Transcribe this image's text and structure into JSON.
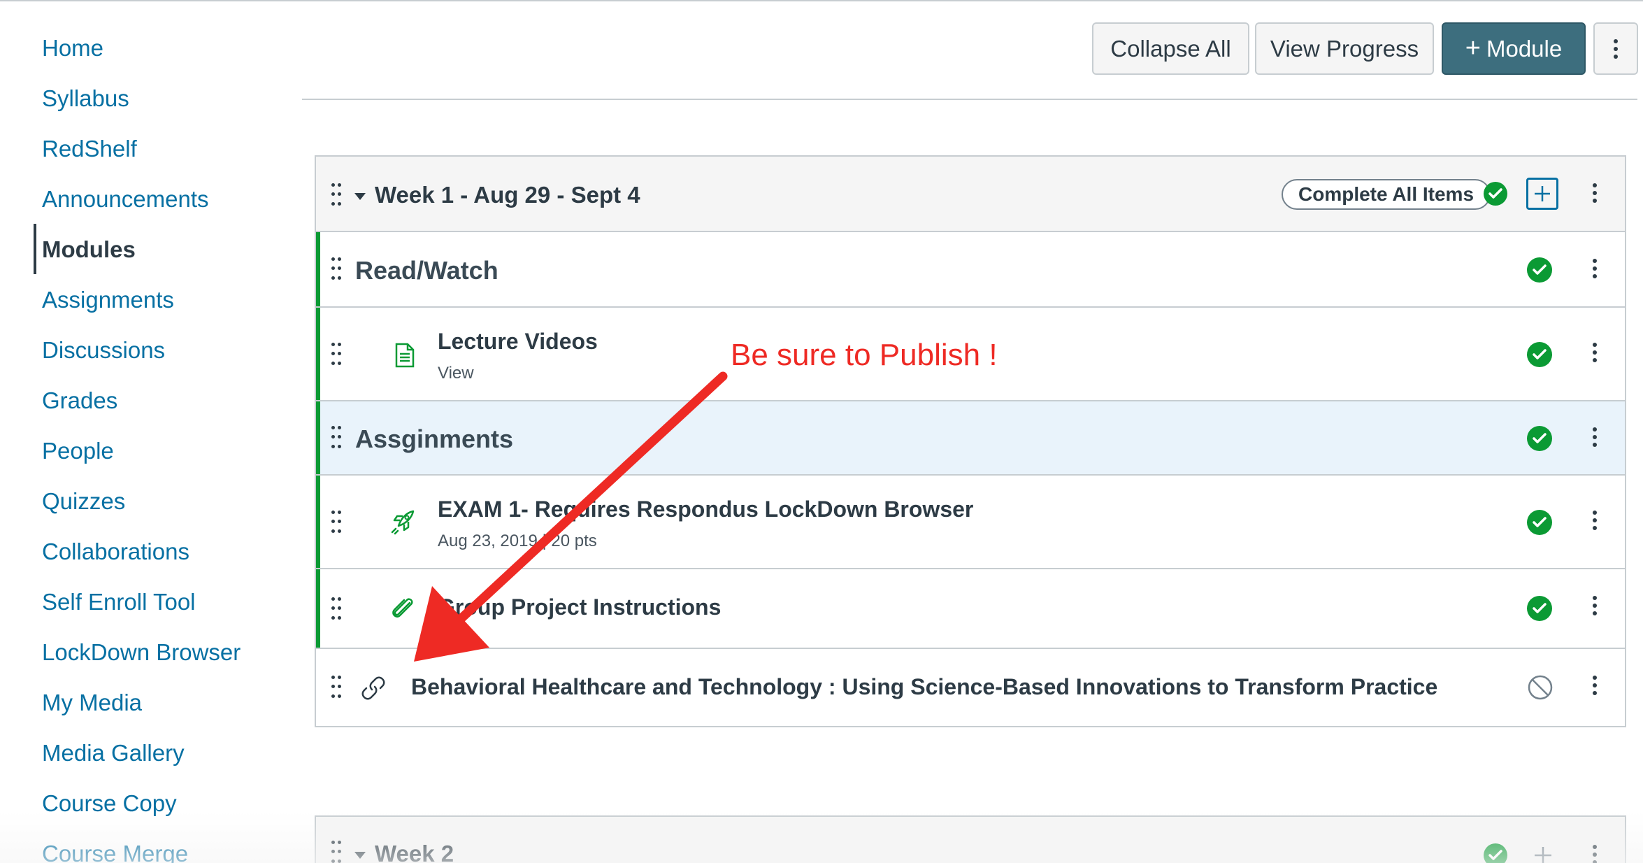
{
  "sidebar": {
    "items": [
      {
        "label": "Home"
      },
      {
        "label": "Syllabus"
      },
      {
        "label": "RedShelf"
      },
      {
        "label": "Announcements"
      },
      {
        "label": "Modules",
        "active": true
      },
      {
        "label": "Assignments"
      },
      {
        "label": "Discussions"
      },
      {
        "label": "Grades"
      },
      {
        "label": "People"
      },
      {
        "label": "Quizzes"
      },
      {
        "label": "Collaborations"
      },
      {
        "label": "Self Enroll Tool"
      },
      {
        "label": "LockDown Browser"
      },
      {
        "label": "My Media"
      },
      {
        "label": "Media Gallery"
      },
      {
        "label": "Course Copy"
      },
      {
        "label": "Course Merge"
      }
    ]
  },
  "toolbar": {
    "collapse_all": "Collapse All",
    "view_progress": "View Progress",
    "add_module": "Module",
    "add_module_icon": "plus-icon",
    "more_icon": "kebab-icon"
  },
  "modules": [
    {
      "title": "Week 1 - Aug 29 - Sept 4",
      "complete_all_label": "Complete All Items",
      "published": true,
      "rows": [
        {
          "kind": "subheader",
          "title": "Read/Watch",
          "published": true
        },
        {
          "kind": "item",
          "icon": "page-icon",
          "title": "Lecture Videos",
          "meta": "View",
          "published": true
        },
        {
          "kind": "subheader",
          "title": "Assginments",
          "published": true
        },
        {
          "kind": "item",
          "icon": "quiz-rocket-icon",
          "title": "EXAM 1- Requires Respondus LockDown Browser",
          "meta": "Aug 23, 2019 | 20 pts",
          "published": true
        },
        {
          "kind": "item",
          "icon": "attachment-icon",
          "title": "Group Project Instructions",
          "meta": "",
          "published": true
        },
        {
          "kind": "item",
          "icon": "link-icon",
          "title": "Behavioral Healthcare and Technology : Using Science-Based Innovations to Transform Practice",
          "meta": "",
          "published": false
        }
      ]
    },
    {
      "title": "Week 2",
      "published": true
    }
  ],
  "annotation": {
    "text": "Be sure to Publish !",
    "color": "#ee2a24"
  },
  "colors": {
    "link": "#0770a3",
    "primary_button": "#3d6e7e",
    "published_green": "#0b9a34",
    "text": "#2d3b45"
  }
}
